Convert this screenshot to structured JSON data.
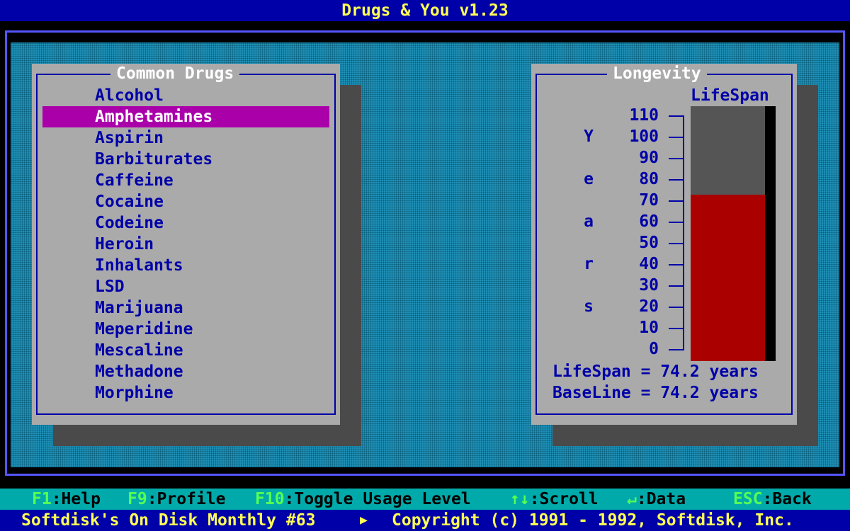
{
  "app": {
    "title": "Drugs & You v1.23"
  },
  "drug_list": {
    "title": "Common Drugs",
    "selected_index": 1,
    "items": [
      "Alcohol",
      "Amphetamines",
      "Aspirin",
      "Barbiturates",
      "Caffeine",
      "Cocaine",
      "Codeine",
      "Heroin",
      "Inhalants",
      "LSD",
      "Marijuana",
      "Meperidine",
      "Mescaline",
      "Methadone",
      "Morphine"
    ]
  },
  "longevity": {
    "title": "Longevity",
    "bar_label": "LifeSpan",
    "axis_letters": [
      "Y",
      "e",
      "a",
      "r",
      "s"
    ],
    "ticks": [
      "110",
      "100",
      "90",
      "80",
      "70",
      "60",
      "50",
      "40",
      "30",
      "20",
      "10",
      "0"
    ],
    "axis_max": 110,
    "lifespan_value": 74.2,
    "lifespan_text": "LifeSpan = 74.2 years",
    "baseline_text": "BaseLine = 74.2 years",
    "colors": {
      "fill": "#aa0000",
      "empty": "#555555",
      "edge": "#000000"
    }
  },
  "keybar": {
    "items": [
      {
        "key": "F1",
        "action": ":Help"
      },
      {
        "key": "F9",
        "action": ":Profile"
      },
      {
        "key": "F10",
        "action": ":Toggle Usage Level"
      },
      {
        "key": "↑↓",
        "action": ":Scroll"
      },
      {
        "key": "↵",
        "action": ":Data"
      },
      {
        "key": "ESC",
        "action": ":Back"
      }
    ]
  },
  "footer": {
    "left": "Softdisk's On Disk Monthly #63",
    "arrow": "▶",
    "right": "Copyright (c) 1991 - 1992, Softdisk, Inc."
  }
}
